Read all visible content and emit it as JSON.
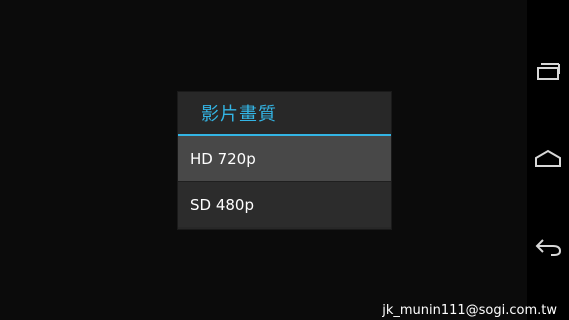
{
  "dialog": {
    "title": "影片畫質",
    "options": [
      {
        "label": "HD 720p",
        "highlighted": true
      },
      {
        "label": "SD 480p",
        "highlighted": false
      }
    ]
  },
  "navbar": {
    "icons": [
      "recent-apps-icon",
      "home-icon",
      "back-icon"
    ]
  },
  "watermark": "jk_munin111@sogi.com.tw",
  "colors": {
    "accent": "#33b5e5",
    "dialog_bg": "#282828",
    "highlight_bg": "#484848",
    "screen_bg": "#0b0b0b"
  }
}
